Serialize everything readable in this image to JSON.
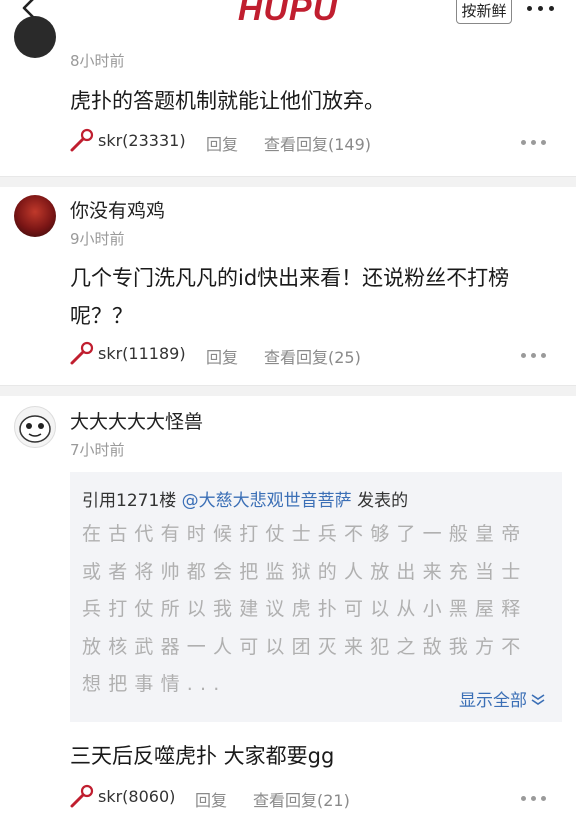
{
  "header": {
    "logo": "HUPU",
    "sort_label": "按新鲜"
  },
  "comments": [
    {
      "time": "8小时前",
      "content": "虎扑的答题机制就能让他们放弃。",
      "skr": "skr(23331)",
      "reply": "回复",
      "view_replies": "查看回复(149)"
    },
    {
      "username": "你没有鸡鸡",
      "time": "9小时前",
      "content": "几个专门洗凡凡的id快出来看！还说粉丝不打榜呢？？",
      "skr": "skr(11189)",
      "reply": "回复",
      "view_replies": "查看回复(25)"
    },
    {
      "username": "大大大大大怪兽",
      "time": "7小时前",
      "quote": {
        "prefix": "引用1271楼 ",
        "mention": "@大慈大悲观世音菩萨",
        "suffix": " 发表的",
        "text": "在古代有时候打仗士兵不够了一般皇帝或者将帅都会把监狱的人放出来充当士兵打仗所以我建议虎扑可以从小黑屋释放核武器一人可以团灭来犯之敌我方不想把事情...",
        "show_all": "显示全部"
      },
      "content": "三天后反噬虎扑 大家都要gg",
      "skr": "skr(8060)",
      "reply": "回复",
      "view_replies": "查看回复(21)"
    }
  ],
  "colors": {
    "brand": "#c01e2f",
    "link": "#3b6fb6",
    "muted": "#9a9a9a"
  }
}
